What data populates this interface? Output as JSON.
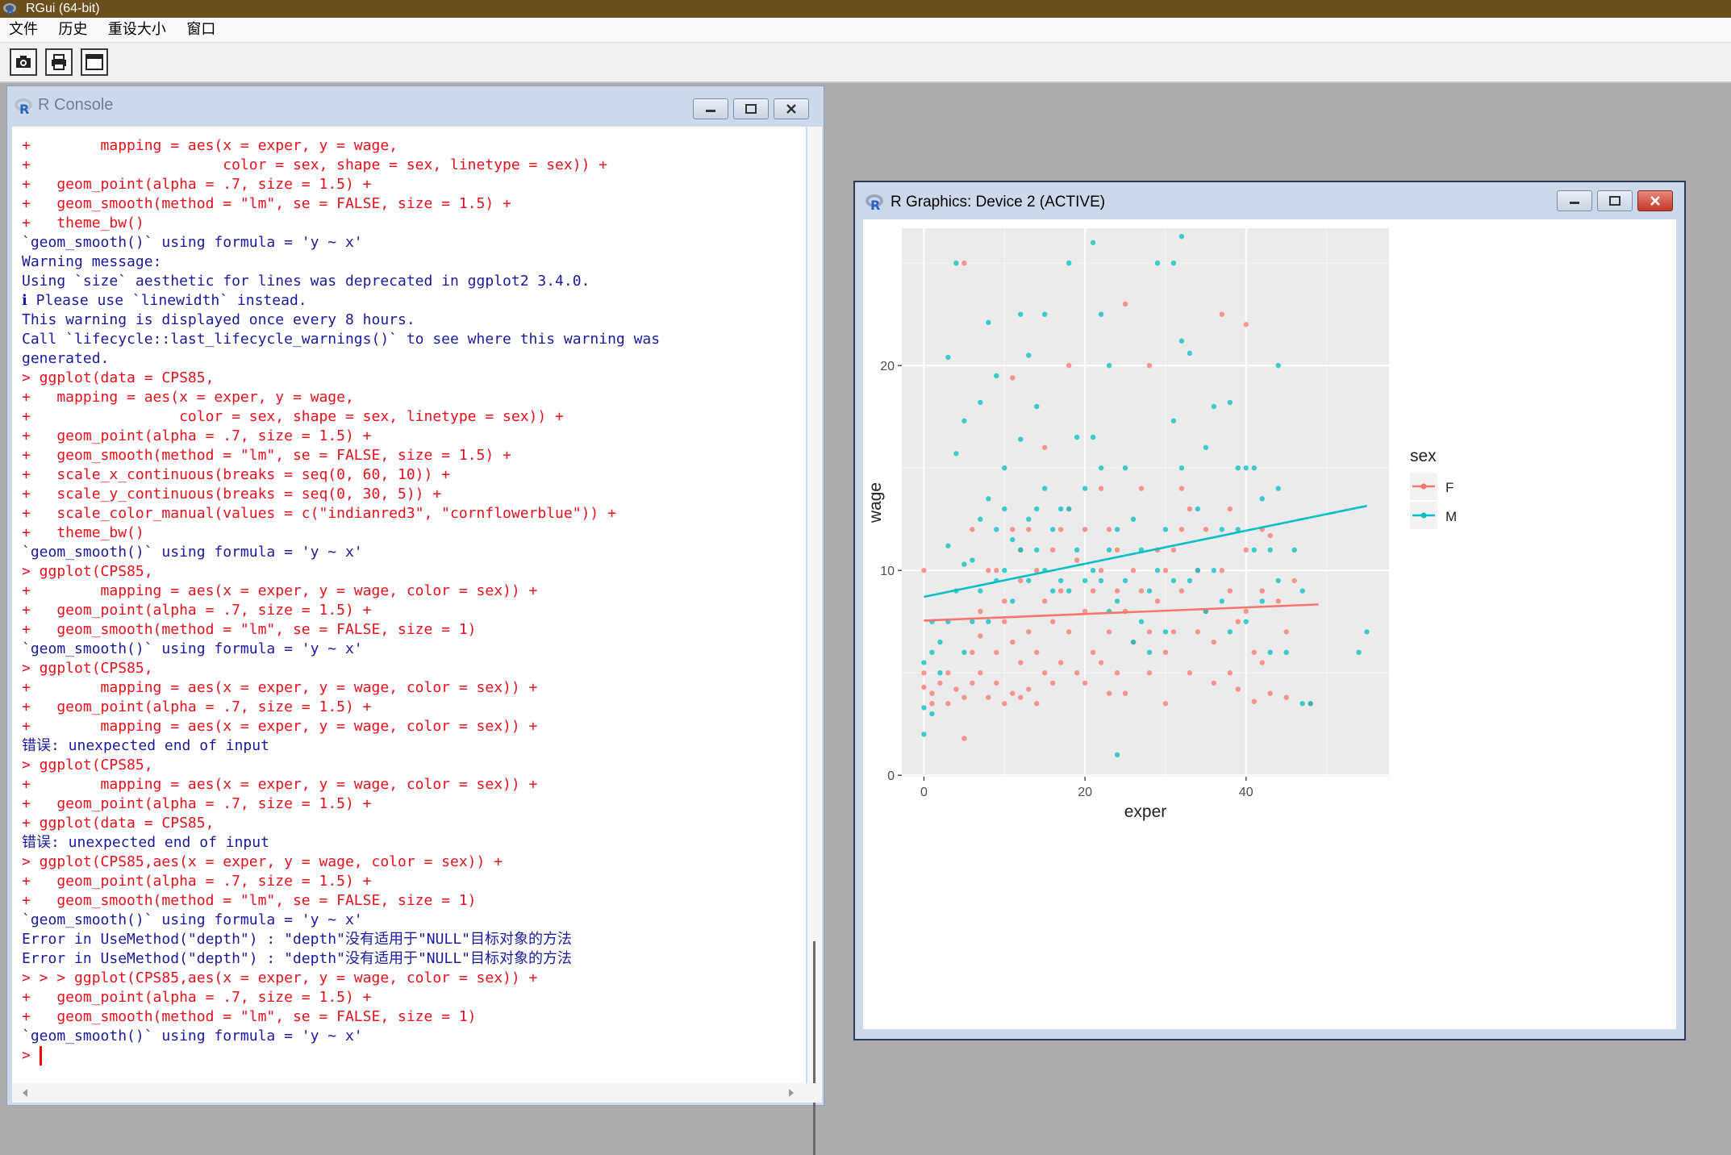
{
  "app": {
    "title": "RGui (64-bit)"
  },
  "menu": {
    "items": [
      "文件",
      "历史",
      "重设大小",
      "窗口"
    ]
  },
  "toolbar": {
    "buttons": [
      "camera-icon",
      "printer-icon",
      "window-icon"
    ]
  },
  "console": {
    "title": "R Console",
    "lines": [
      {
        "t": "+        mapping = aes(x = exper, y = wage,",
        "c": "cmd"
      },
      {
        "t": "+                      color = sex, shape = sex, linetype = sex)) +",
        "c": "cmd"
      },
      {
        "t": "+   geom_point(alpha = .7, size = 1.5) +",
        "c": "cmd"
      },
      {
        "t": "+   geom_smooth(method = \"lm\", se = FALSE, size = 1.5) +",
        "c": "cmd"
      },
      {
        "t": "+   theme_bw()",
        "c": "cmd"
      },
      {
        "t": "`geom_smooth()` using formula = 'y ~ x'",
        "c": "out"
      },
      {
        "t": "Warning message:",
        "c": "out"
      },
      {
        "t": "Using `size` aesthetic for lines was deprecated in ggplot2 3.4.0.",
        "c": "out"
      },
      {
        "t": "ℹ Please use `linewidth` instead.",
        "c": "out"
      },
      {
        "t": "This warning is displayed once every 8 hours.",
        "c": "out"
      },
      {
        "t": "Call `lifecycle::last_lifecycle_warnings()` to see where this warning was",
        "c": "out"
      },
      {
        "t": "generated.",
        "c": "out"
      },
      {
        "t": "> ggplot(data = CPS85,",
        "c": "cmd"
      },
      {
        "t": "+   mapping = aes(x = exper, y = wage,",
        "c": "cmd"
      },
      {
        "t": "+                 color = sex, shape = sex, linetype = sex)) +",
        "c": "cmd"
      },
      {
        "t": "+   geom_point(alpha = .7, size = 1.5) +",
        "c": "cmd"
      },
      {
        "t": "+   geom_smooth(method = \"lm\", se = FALSE, size = 1.5) +",
        "c": "cmd"
      },
      {
        "t": "+   scale_x_continuous(breaks = seq(0, 60, 10)) +",
        "c": "cmd"
      },
      {
        "t": "+   scale_y_continuous(breaks = seq(0, 30, 5)) +",
        "c": "cmd"
      },
      {
        "t": "+   scale_color_manual(values = c(\"indianred3\", \"cornflowerblue\")) +",
        "c": "cmd"
      },
      {
        "t": "+   theme_bw()",
        "c": "cmd"
      },
      {
        "t": "`geom_smooth()` using formula = 'y ~ x'",
        "c": "out"
      },
      {
        "t": "> ggplot(CPS85,",
        "c": "cmd"
      },
      {
        "t": "+        mapping = aes(x = exper, y = wage, color = sex)) +",
        "c": "cmd"
      },
      {
        "t": "+   geom_point(alpha = .7, size = 1.5) +",
        "c": "cmd"
      },
      {
        "t": "+   geom_smooth(method = \"lm\", se = FALSE, size = 1)",
        "c": "cmd"
      },
      {
        "t": "`geom_smooth()` using formula = 'y ~ x'",
        "c": "out"
      },
      {
        "t": "> ggplot(CPS85,",
        "c": "cmd"
      },
      {
        "t": "+        mapping = aes(x = exper, y = wage, color = sex)) +",
        "c": "cmd"
      },
      {
        "t": "+   geom_point(alpha = .7, size = 1.5) +",
        "c": "cmd"
      },
      {
        "t": "+        mapping = aes(x = exper, y = wage, color = sex)) +",
        "c": "cmd"
      },
      {
        "t": "错误: unexpected end of input",
        "c": "out"
      },
      {
        "t": "> ggplot(CPS85,",
        "c": "cmd"
      },
      {
        "t": "+        mapping = aes(x = exper, y = wage, color = sex)) +",
        "c": "cmd"
      },
      {
        "t": "+   geom_point(alpha = .7, size = 1.5) +",
        "c": "cmd"
      },
      {
        "t": "+ ggplot(data = CPS85,",
        "c": "cmd"
      },
      {
        "t": "错误: unexpected end of input",
        "c": "out"
      },
      {
        "t": "> ggplot(CPS85,aes(x = exper, y = wage, color = sex)) +",
        "c": "cmd"
      },
      {
        "t": "+   geom_point(alpha = .7, size = 1.5) +",
        "c": "cmd"
      },
      {
        "t": "+   geom_smooth(method = \"lm\", se = FALSE, size = 1)",
        "c": "cmd"
      },
      {
        "t": "`geom_smooth()` using formula = 'y ~ x'",
        "c": "out"
      },
      {
        "t": "Error in UseMethod(\"depth\") : \"depth\"没有适用于\"NULL\"目标对象的方法",
        "c": "out"
      },
      {
        "t": "Error in UseMethod(\"depth\") : \"depth\"没有适用于\"NULL\"目标对象的方法",
        "c": "out"
      },
      {
        "t": "> > > ggplot(CPS85,aes(x = exper, y = wage, color = sex)) +",
        "c": "cmd"
      },
      {
        "t": "+   geom_point(alpha = .7, size = 1.5) +",
        "c": "cmd"
      },
      {
        "t": "+   geom_smooth(method = \"lm\", se = FALSE, size = 1)",
        "c": "cmd"
      },
      {
        "t": "`geom_smooth()` using formula = 'y ~ x'",
        "c": "out"
      },
      {
        "t": "> ",
        "c": "cmd"
      }
    ]
  },
  "graphics": {
    "title": "R Graphics: Device 2 (ACTIVE)"
  },
  "colors": {
    "female": "#f8766d",
    "male": "#00bfc4",
    "panel": "#ebebeb"
  },
  "chart_data": {
    "type": "scatter",
    "xlabel": "exper",
    "ylabel": "wage",
    "xlim": [
      -2.75,
      57.75
    ],
    "ylim": [
      -0.07,
      26.7
    ],
    "x_ticks": [
      0,
      20,
      40
    ],
    "y_ticks": [
      0,
      10,
      20
    ],
    "legend": {
      "title": "sex",
      "entries": [
        "F",
        "M"
      ],
      "position": "right"
    },
    "series": [
      {
        "name": "F",
        "color": "#f8766d",
        "points": [
          [
            0,
            10
          ],
          [
            0,
            4.3
          ],
          [
            0,
            5
          ],
          [
            1,
            4
          ],
          [
            1,
            3.5
          ],
          [
            2,
            4.5
          ],
          [
            3,
            5
          ],
          [
            3,
            3.5
          ],
          [
            4,
            4.2
          ],
          [
            5,
            25
          ],
          [
            5,
            1.8
          ],
          [
            5,
            3.8
          ],
          [
            6,
            12
          ],
          [
            6,
            4.5
          ],
          [
            6,
            6
          ],
          [
            7,
            6.8
          ],
          [
            7,
            5
          ],
          [
            7,
            8
          ],
          [
            8,
            10
          ],
          [
            8,
            3.8
          ],
          [
            9,
            6
          ],
          [
            9,
            10
          ],
          [
            9,
            4.5
          ],
          [
            10,
            7.5
          ],
          [
            10,
            3.5
          ],
          [
            10,
            8.5
          ],
          [
            11,
            19.4
          ],
          [
            11,
            12
          ],
          [
            11,
            6.5
          ],
          [
            11,
            4
          ],
          [
            12,
            11
          ],
          [
            12,
            5.5
          ],
          [
            12,
            9.5
          ],
          [
            12,
            3.8
          ],
          [
            13,
            12
          ],
          [
            13,
            7
          ],
          [
            13,
            4.2
          ],
          [
            14,
            10
          ],
          [
            14,
            6
          ],
          [
            14,
            3.5
          ],
          [
            15,
            16
          ],
          [
            15,
            8.5
          ],
          [
            15,
            5
          ],
          [
            16,
            11
          ],
          [
            16,
            7.5
          ],
          [
            16,
            4.5
          ],
          [
            17,
            12
          ],
          [
            17,
            9
          ],
          [
            17,
            5.5
          ],
          [
            18,
            20
          ],
          [
            18,
            13
          ],
          [
            18,
            7
          ],
          [
            19,
            10.5
          ],
          [
            19,
            5
          ],
          [
            20,
            12
          ],
          [
            20,
            8
          ],
          [
            20,
            4.5
          ],
          [
            21,
            9
          ],
          [
            21,
            6
          ],
          [
            22,
            14
          ],
          [
            22,
            10
          ],
          [
            22,
            5.5
          ],
          [
            23,
            12
          ],
          [
            23,
            7
          ],
          [
            23,
            4
          ],
          [
            24,
            11
          ],
          [
            24,
            9
          ],
          [
            24,
            5
          ],
          [
            25,
            23
          ],
          [
            25,
            8
          ],
          [
            25,
            4
          ],
          [
            26,
            10
          ],
          [
            26,
            6.5
          ],
          [
            27,
            14
          ],
          [
            27,
            9
          ],
          [
            28,
            20
          ],
          [
            28,
            7
          ],
          [
            28,
            5
          ],
          [
            29,
            11
          ],
          [
            29,
            8.5
          ],
          [
            30,
            10
          ],
          [
            30,
            6
          ],
          [
            30,
            3.5
          ],
          [
            31,
            11
          ],
          [
            31,
            7
          ],
          [
            32,
            14
          ],
          [
            32,
            12
          ],
          [
            32,
            9
          ],
          [
            33,
            13
          ],
          [
            33,
            5
          ],
          [
            34,
            10
          ],
          [
            34,
            7
          ],
          [
            35,
            12
          ],
          [
            35,
            8
          ],
          [
            36,
            6.5
          ],
          [
            36,
            4.5
          ],
          [
            37,
            22.5
          ],
          [
            37,
            10
          ],
          [
            38,
            13
          ],
          [
            38,
            9
          ],
          [
            38,
            5
          ],
          [
            39,
            7.5
          ],
          [
            39,
            4.2
          ],
          [
            40,
            22
          ],
          [
            40,
            11
          ],
          [
            40,
            8
          ],
          [
            41,
            6
          ],
          [
            41,
            3.6
          ],
          [
            42,
            12
          ],
          [
            42,
            9
          ],
          [
            42,
            5.5
          ],
          [
            43,
            11.7
          ],
          [
            43,
            4
          ],
          [
            44,
            8.5
          ],
          [
            45,
            7
          ],
          [
            45,
            3.8
          ],
          [
            46,
            9.5
          ],
          [
            48,
            3.5
          ]
        ]
      },
      {
        "name": "M",
        "color": "#00bfc4",
        "points": [
          [
            0,
            2
          ],
          [
            0,
            3.3
          ],
          [
            0,
            5.5
          ],
          [
            1,
            6
          ],
          [
            1,
            7.5
          ],
          [
            1,
            3
          ],
          [
            2,
            6.5
          ],
          [
            2,
            5
          ],
          [
            3,
            11.2
          ],
          [
            3,
            20.4
          ],
          [
            3,
            7.5
          ],
          [
            4,
            25
          ],
          [
            4,
            15.7
          ],
          [
            4,
            9
          ],
          [
            5,
            17.3
          ],
          [
            5,
            10.3
          ],
          [
            5,
            6
          ],
          [
            6,
            10.5
          ],
          [
            6,
            7.5
          ],
          [
            7,
            18.2
          ],
          [
            7,
            12.5
          ],
          [
            7,
            9
          ],
          [
            8,
            22.1
          ],
          [
            8,
            13.5
          ],
          [
            8,
            7.5
          ],
          [
            9,
            19.5
          ],
          [
            9,
            12
          ],
          [
            9,
            9.5
          ],
          [
            10,
            15
          ],
          [
            10,
            13
          ],
          [
            10,
            10
          ],
          [
            11,
            11.5
          ],
          [
            11,
            8.5
          ],
          [
            12,
            22.5
          ],
          [
            12,
            16.4
          ],
          [
            12,
            11
          ],
          [
            13,
            20.5
          ],
          [
            13,
            12.5
          ],
          [
            13,
            9.5
          ],
          [
            14,
            18
          ],
          [
            14,
            13
          ],
          [
            14,
            11
          ],
          [
            15,
            22.5
          ],
          [
            15,
            14
          ],
          [
            15,
            10
          ],
          [
            16,
            12
          ],
          [
            16,
            9
          ],
          [
            17,
            13
          ],
          [
            17,
            9.5
          ],
          [
            18,
            25
          ],
          [
            18,
            13
          ],
          [
            18,
            9
          ],
          [
            19,
            16.5
          ],
          [
            19,
            11
          ],
          [
            20,
            14
          ],
          [
            20,
            9.5
          ],
          [
            21,
            26
          ],
          [
            21,
            16.5
          ],
          [
            21,
            10
          ],
          [
            22,
            22.5
          ],
          [
            22,
            15
          ],
          [
            22,
            9.5
          ],
          [
            23,
            20
          ],
          [
            23,
            11
          ],
          [
            23,
            8
          ],
          [
            24,
            1
          ],
          [
            24,
            12
          ],
          [
            24,
            8.5
          ],
          [
            25,
            15
          ],
          [
            25,
            9.5
          ],
          [
            26,
            12.5
          ],
          [
            26,
            6.5
          ],
          [
            27,
            11
          ],
          [
            27,
            7.5
          ],
          [
            28,
            9
          ],
          [
            28,
            6
          ],
          [
            29,
            25
          ],
          [
            29,
            10
          ],
          [
            30,
            12
          ],
          [
            30,
            7
          ],
          [
            31,
            25
          ],
          [
            31,
            17.3
          ],
          [
            31,
            9.5
          ],
          [
            32,
            26.3
          ],
          [
            32,
            21.2
          ],
          [
            32,
            15
          ],
          [
            33,
            20.6
          ],
          [
            33,
            9.5
          ],
          [
            34,
            13
          ],
          [
            34,
            10
          ],
          [
            35,
            16
          ],
          [
            35,
            8
          ],
          [
            36,
            18
          ],
          [
            36,
            10
          ],
          [
            37,
            12
          ],
          [
            37,
            8.5
          ],
          [
            38,
            18.2
          ],
          [
            38,
            7
          ],
          [
            39,
            15
          ],
          [
            39,
            12
          ],
          [
            40,
            15
          ],
          [
            40,
            7.5
          ],
          [
            41,
            15
          ],
          [
            41,
            11
          ],
          [
            42,
            13.5
          ],
          [
            42,
            8.5
          ],
          [
            43,
            11
          ],
          [
            43,
            6
          ],
          [
            44,
            20
          ],
          [
            44,
            14
          ],
          [
            44,
            9.5
          ],
          [
            45,
            6
          ],
          [
            46,
            11
          ],
          [
            47,
            9
          ],
          [
            47,
            3.5
          ],
          [
            48,
            3.5
          ],
          [
            54,
            6
          ],
          [
            55,
            7
          ]
        ]
      }
    ],
    "fits": [
      {
        "name": "F",
        "x": [
          0,
          49
        ],
        "y": [
          7.55,
          8.34
        ]
      },
      {
        "name": "M",
        "x": [
          0,
          55
        ],
        "y": [
          8.71,
          13.15
        ]
      }
    ]
  }
}
